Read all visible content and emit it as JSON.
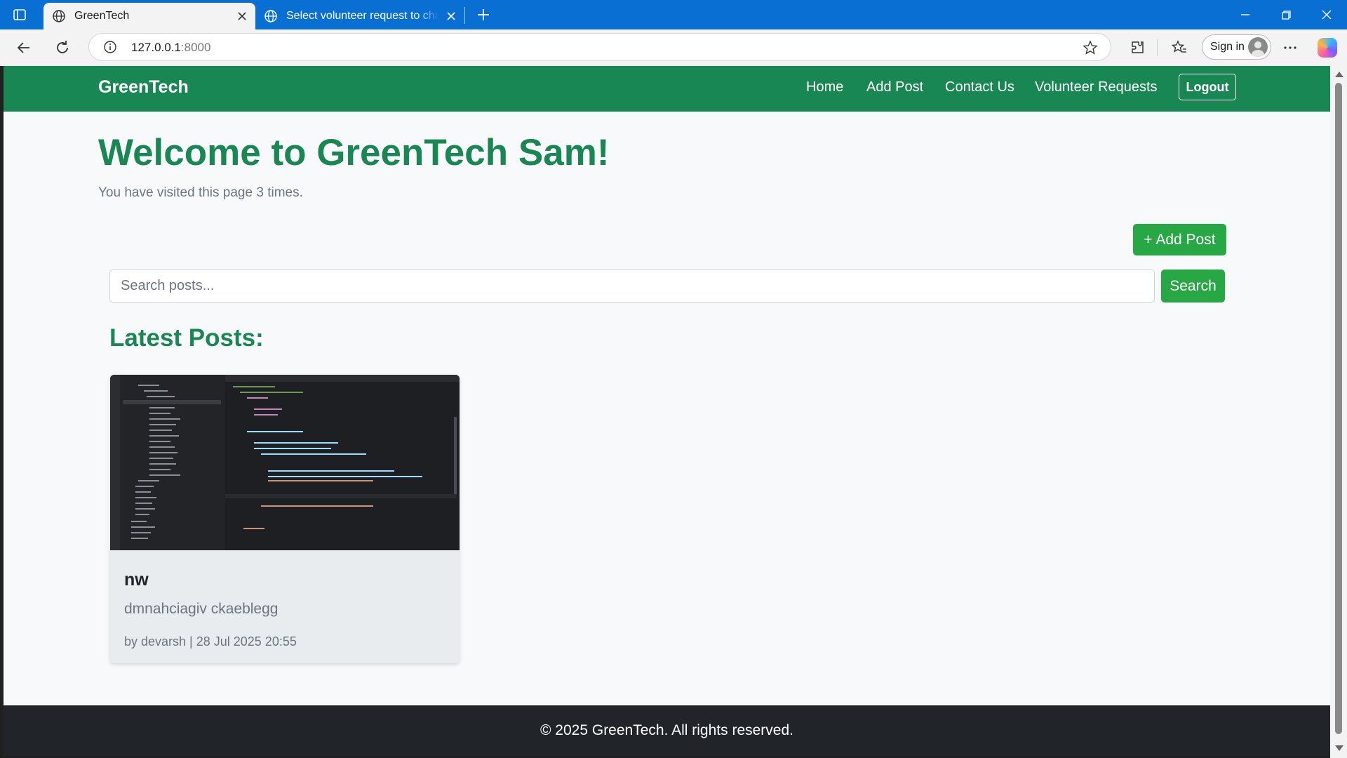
{
  "browser": {
    "tabs": [
      {
        "title": "GreenTech",
        "active": true
      },
      {
        "title": "Select volunteer request to change",
        "active": false
      }
    ],
    "address": {
      "host": "127.0.0.1",
      "port": ":8000"
    },
    "signin_label": "Sign in"
  },
  "navbar": {
    "brand": "GreenTech",
    "links": [
      "Home",
      "Add Post",
      "Contact Us",
      "Volunteer Requests"
    ],
    "logout": "Logout"
  },
  "main": {
    "welcome": "Welcome to GreenTech Sam!",
    "visits": "You have visited this page 3 times.",
    "add_post_button": "+ Add Post",
    "search": {
      "placeholder": "Search posts...",
      "value": "",
      "button": "Search"
    },
    "latest_heading": "Latest Posts:"
  },
  "posts": [
    {
      "title": "nw",
      "description": "dmnahciagiv ckaeblegg",
      "meta": "by devarsh | 28 Jul 2025 20:55"
    }
  ],
  "footer": {
    "text": "© 2025 GreenTech. All rights reserved."
  },
  "colors": {
    "brand_green": "#198754",
    "button_green": "#28a745",
    "footer_dark": "#212529",
    "titlebar_blue": "#0a6fd3"
  },
  "icons": [
    "sidebar-toggle-icon",
    "globe-icon",
    "close-icon",
    "plus-icon",
    "minimize-icon",
    "maximize-icon",
    "back-icon",
    "refresh-icon",
    "info-icon",
    "star-icon",
    "extensions-icon",
    "favorites-icon",
    "more-icon",
    "copilot-icon"
  ]
}
